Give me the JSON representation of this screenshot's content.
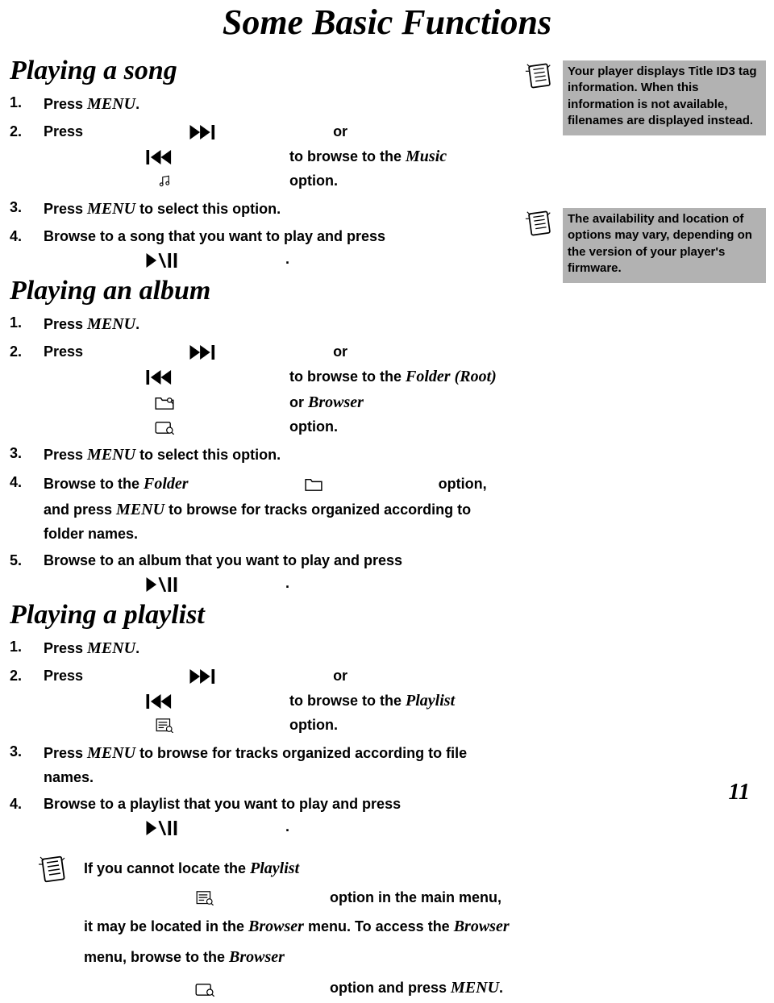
{
  "page": {
    "title": "Some Basic Functions",
    "number": "11"
  },
  "sections": {
    "song": {
      "heading": "Playing a song",
      "s1": {
        "num": "1.",
        "a": "Press ",
        "menu": "MENU",
        "b": "."
      },
      "s2": {
        "num": "2.",
        "a": "Press ",
        "or": " or ",
        "b": " to browse to the ",
        "music": "Music",
        "c": " option."
      },
      "s3": {
        "num": "3.",
        "a": "Press ",
        "menu": "MENU",
        "b": " to select this option."
      },
      "s4": {
        "num": "4.",
        "a": "Browse to a song that you want to play and press ",
        "b": "."
      }
    },
    "album": {
      "heading": "Playing an album",
      "s1": {
        "num": "1.",
        "a": "Press ",
        "menu": "MENU",
        "b": "."
      },
      "s2": {
        "num": "2.",
        "a": "Press ",
        "or_text": " or ",
        "b": " to browse to the ",
        "folderroot": "Folder (Root)",
        "or2": " or ",
        "browser": "Browser",
        "c": " option."
      },
      "s3": {
        "num": "3.",
        "a": "Press ",
        "menu": "MENU",
        "b": " to select this option."
      },
      "s4": {
        "num": "4.",
        "a": "Browse to the ",
        "folder": "Folder",
        "b": " option, and press ",
        "menu": "MENU",
        "c": " to browse for tracks organized according to folder names."
      },
      "s5": {
        "num": "5.",
        "a": "Browse to an album that you want to play and press ",
        "b": "."
      }
    },
    "playlist": {
      "heading": "Playing a playlist",
      "s1": {
        "num": "1.",
        "a": "Press ",
        "menu": "MENU",
        "b": "."
      },
      "s2": {
        "num": "2.",
        "a": "Press ",
        "or": " or ",
        "b": " to browse to the ",
        "playlist": "Playlist",
        "c": " option."
      },
      "s3": {
        "num": "3.",
        "a": "Press ",
        "menu": "MENU",
        "b": " to browse for tracks organized according to file names."
      },
      "s4": {
        "num": "4.",
        "a": "Browse to a playlist that you want to play and press ",
        "b": "."
      }
    }
  },
  "sidebar": {
    "note1": "Your player displays Title ID3 tag information. When this information is not available, filenames are displayed instead.",
    "note2": "The availability and location of options may vary, depending on the version of your player's firmware."
  },
  "bottom_note": {
    "a": "If you cannot locate the ",
    "playlist": "Playlist",
    "b": " option in the main menu, it may be located in the ",
    "browser1": "Browser",
    "c": " menu. To access the ",
    "browser2": "Browser",
    "d": " menu, browse to the ",
    "browser3": "Browser",
    "e": " option and press ",
    "menu": "MENU",
    "f": "."
  }
}
